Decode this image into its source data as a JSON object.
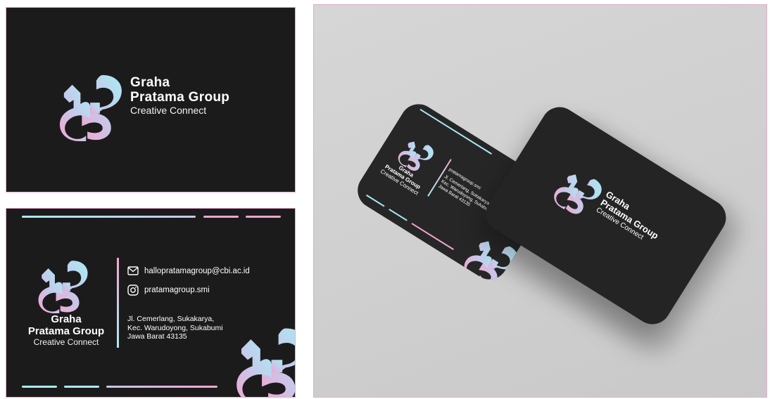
{
  "brand": {
    "name_line1": "Graha",
    "name_line2": "Pratama Group",
    "tagline": "Creative Connect",
    "logo": "interlocking-loop-logo"
  },
  "contact": {
    "email": "hallopratamagroup@cbi.ac.id",
    "instagram": "pratamagroup.smi",
    "address_line1": "Jl. Cemerlang, Sukakarya,",
    "address_line2": "Kec. Warudoyong, Sukabumi",
    "address_line3": "Jawa Barat 43135"
  },
  "colors": {
    "card_background": "#1c1b1c",
    "gradient_cyan": "#a8ecf4",
    "gradient_pink": "#f2a6cf",
    "frame_border": "#e4a9cd"
  },
  "icons": [
    "mail-icon",
    "instagram-icon"
  ]
}
